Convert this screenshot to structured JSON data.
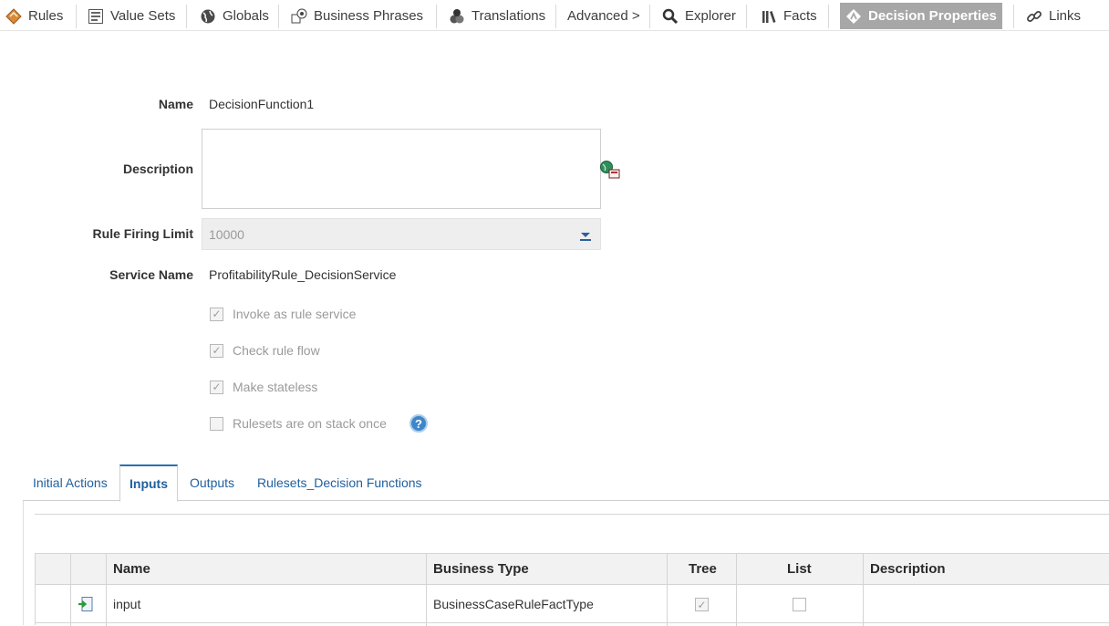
{
  "toolbar": {
    "items": [
      {
        "label": "Rules",
        "icon": "rules-icon"
      },
      {
        "label": "Value Sets",
        "icon": "value-sets-icon"
      },
      {
        "label": "Globals",
        "icon": "globe-icon"
      },
      {
        "label": "Business Phrases",
        "icon": "business-phrases-icon"
      },
      {
        "label": "Translations",
        "icon": "translations-icon"
      },
      {
        "label": "Advanced >",
        "icon": ""
      },
      {
        "label": "Explorer",
        "icon": "magnifier-icon"
      },
      {
        "label": "Facts",
        "icon": "facts-icon"
      },
      {
        "label": "Decision Properties",
        "icon": "decision-properties-icon"
      },
      {
        "label": "Links",
        "icon": "link-icon"
      }
    ],
    "active": "Decision Properties"
  },
  "form": {
    "name_label": "Name",
    "name_value": "DecisionFunction1",
    "description_label": "Description",
    "description_value": "",
    "rule_firing_limit_label": "Rule Firing Limit",
    "rule_firing_limit_value": "10000",
    "service_name_label": "Service Name",
    "service_name_value": "ProfitabilityRule_DecisionService",
    "checkboxes": [
      {
        "label": "Invoke as rule service",
        "checked": true
      },
      {
        "label": "Check rule flow",
        "checked": true
      },
      {
        "label": "Make stateless",
        "checked": true
      },
      {
        "label": "Rulesets are on stack once",
        "checked": false
      }
    ],
    "help_glyph": "?"
  },
  "tabs": [
    {
      "label": "Initial Actions"
    },
    {
      "label": "Inputs"
    },
    {
      "label": "Outputs"
    },
    {
      "label": "Rulesets_Decision Functions"
    }
  ],
  "active_tab": "Inputs",
  "table": {
    "headers": [
      "Name",
      "Business Type",
      "Tree",
      "List",
      "Description"
    ],
    "rows": [
      {
        "name": "input",
        "business_type": "BusinessCaseRuleFactType",
        "tree": true,
        "list": false,
        "description": ""
      }
    ]
  },
  "colors": {
    "accent": "#2a6fb0",
    "active_toolbar_bg": "#a7a7a7",
    "help_blue": "#3e86c8"
  }
}
